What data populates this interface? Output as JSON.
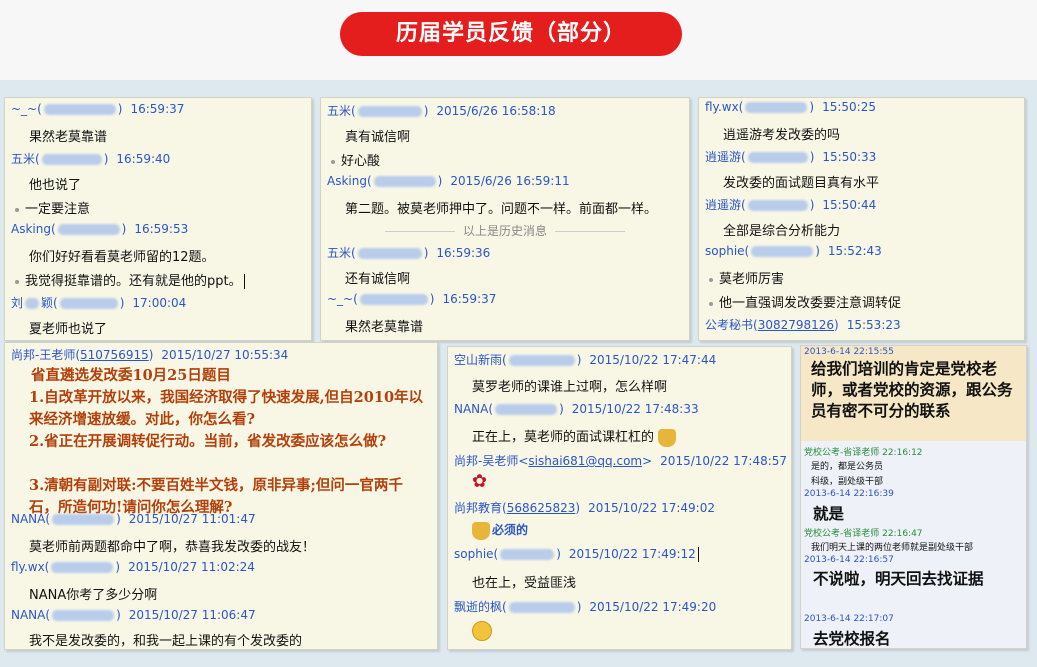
{
  "banner": {
    "title": "历届学员反馈（部分）"
  },
  "panel1": {
    "m1": {
      "name": "~_~(",
      "ts": "16:59:37"
    },
    "t1": "果然老莫靠谱",
    "m2": {
      "name": "五米(",
      "ts": "16:59:40"
    },
    "t2": "他也说了",
    "b1": "一定要注意",
    "m3": {
      "name": "Asking(",
      "ts": "16:59:53"
    },
    "t3": "你们好好看看莫老师留的12题。",
    "b2": "我觉得挺靠谱的。还有就是他的ppt。",
    "m4": {
      "name": "刘",
      "name2": "颖(",
      "ts": "17:00:04"
    },
    "t4": "夏老师也说了"
  },
  "panel2": {
    "m1": {
      "name": "五米(",
      "ts": "2015/6/26 16:58:18"
    },
    "t1": "真有诚信啊",
    "b1": "好心酸",
    "m2": {
      "name": "Asking(",
      "ts": "2015/6/26 16:59:11"
    },
    "t2": "第二题。被莫老师押中了。问题不一样。前面都一样。",
    "div": "以上是历史消息",
    "m3": {
      "name": "五米(",
      "ts": "16:59:36"
    },
    "t3": "还有诚信啊",
    "m4": {
      "name": "~_~(",
      "ts": "16:59:37"
    },
    "t4": "果然老莫靠谱"
  },
  "panel3": {
    "m1": {
      "name": "fly.wx(",
      "ts": "15:50:25"
    },
    "t1": "逍遥游考发改委的吗",
    "m2": {
      "name": "逍遥游(",
      "ts": "15:50:33"
    },
    "t2": "发改委的面试题目真有水平",
    "m3": {
      "name": "逍遥游(",
      "ts": "15:50:44"
    },
    "t3": "全部是综合分析能力",
    "m4": {
      "name": "sophie(",
      "ts": "15:52:43"
    },
    "b1": "莫老师厉害",
    "b2": "他一直强调发改委要注意调转促",
    "m5": {
      "name": "公考秘书(",
      "qq": "3082798126",
      "ts": "15:53:23"
    }
  },
  "panel4": {
    "m1": {
      "name": "尚邦-王老师(",
      "qq": "510756915",
      "ts": "2015/10/27 10:55:34"
    },
    "exam_title": "省直遴选发改委10月25日题目",
    "q1": "1.自改革开放以来，我国经济取得了快速发展,但自2010年以来经济增速放缓。对此，你怎么看?",
    "q2": "2.省正在开展调转促行动。当前，省发改委应该怎么做?",
    "q3": "3.清朝有副对联:不要百姓半文钱，原非异事;但问一官两千石，所造何功!请问你怎么理解?",
    "m2": {
      "name": "NANA(",
      "ts": "2015/10/27 11:01:47"
    },
    "t2": "莫老师前两题都命中了啊，恭喜我发改委的战友！",
    "m3": {
      "name": "fly.wx(",
      "ts": "2015/10/27 11:02:24"
    },
    "t3": "NANA你考了多少分啊",
    "m4": {
      "name": "NANA(",
      "ts": "2015/10/27 11:06:47"
    },
    "t4": "我不是发改委的，和我一起上课的有个发改委的"
  },
  "panel5": {
    "m1": {
      "name": "空山新雨(",
      "ts": "2015/10/22 17:47:44"
    },
    "t1": "莫罗老师的课谁上过啊，怎么样啊",
    "m2": {
      "name": "NANA(",
      "ts": "2015/10/22 17:48:33"
    },
    "t2": "正在上，莫老师的面试课杠杠的",
    "m3": {
      "name": "尚邦-吴老师<",
      "qq": "sishai681@qq.com",
      "tail": ">",
      "ts": "2015/10/22 17:48:57"
    },
    "m4": {
      "name": "尚邦教育(",
      "qq": "568625823",
      "ts": "2015/10/22 17:49:02"
    },
    "t4": "必须的",
    "m5": {
      "name": "sophie(",
      "ts": "2015/10/22 17:49:12"
    },
    "t5": "也在上，受益匪浅",
    "m6": {
      "name": "飘逝的枫(",
      "ts": "2015/10/22 17:49:20"
    }
  },
  "panel6": {
    "ts1": "2013-6-14 22:15:55",
    "h1": "给我们培训的肯定是党校老师，或者党校的资源，跟公务员有密不可分的联系",
    "g1": "党校公考-省译老师 22:16:12",
    "s1": "是的，都是公务员",
    "s2": "科级，副处级干部",
    "ts2": "2013-6-14 22:16:39",
    "h2": "就是",
    "g2": "党校公考-省译老师 22:16:47",
    "s3": "我们明天上课的两位老师就是副处级干部",
    "ts3": "2013-6-14 22:16:57",
    "h3": "不说啦，明天回去找证据",
    "ts4": "2013-6-14 22:17:07",
    "h4": "去党校报名"
  },
  "colors": {
    "banner": "#e41d1d",
    "panel": "#f8f7e6",
    "link": "#2b55c8",
    "exam": "#b2400b"
  }
}
